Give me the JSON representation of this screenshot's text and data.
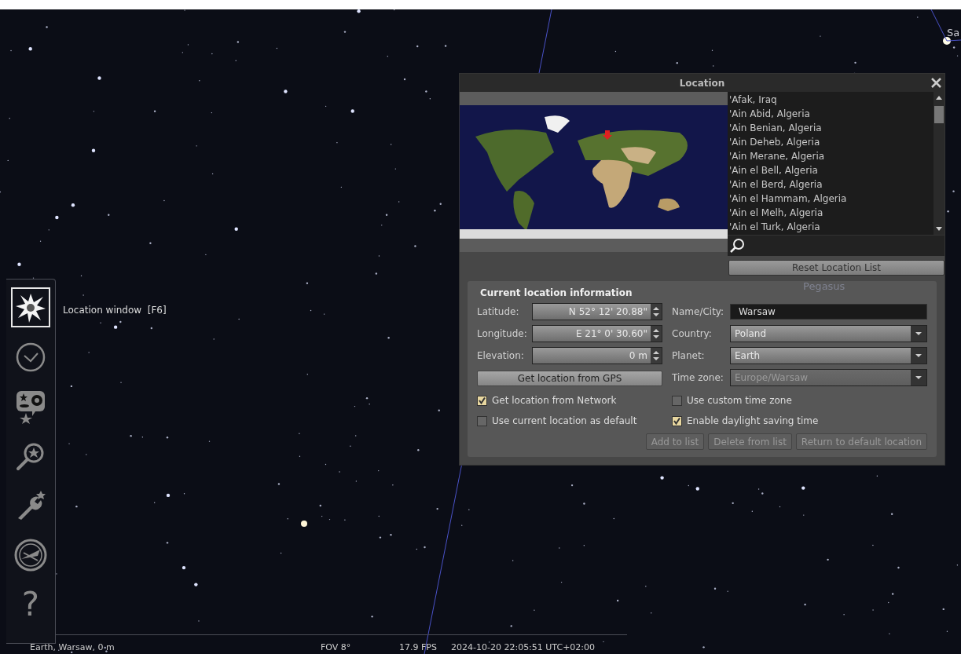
{
  "sky": {
    "planet_label": "Sa",
    "constellation_label": "Pegasus"
  },
  "toolbar": {
    "items": [
      {
        "kind": "location",
        "selected": true
      },
      {
        "kind": "clock",
        "selected": false
      },
      {
        "kind": "sky-objects",
        "selected": false
      },
      {
        "kind": "search",
        "selected": false
      },
      {
        "kind": "settings",
        "selected": false
      },
      {
        "kind": "view",
        "selected": false
      },
      {
        "kind": "help",
        "label": "?",
        "selected": false
      }
    ],
    "tooltip": "Location window  [F6]"
  },
  "location_dialog": {
    "title": "Location",
    "locations": [
      "'Afak, Iraq",
      "'Ain Abid, Algeria",
      "'Ain Benian, Algeria",
      "'Ain Deheb, Algeria",
      "'Ain Merane, Algeria",
      "'Ain el Bell, Algeria",
      "'Ain el Berd, Algeria",
      "'Ain el Hammam, Algeria",
      "'Ain el Melh, Algeria",
      "'Ain el Turk, Algeria"
    ],
    "reset_button": "Reset Location List",
    "current": {
      "title": "Current location information",
      "spinners": [
        {
          "label": "Latitude:",
          "value": "N 52° 12' 20.88\""
        },
        {
          "label": "Longitude:",
          "value": "E 21° 0' 30.60\""
        },
        {
          "label": "Elevation:",
          "value": "0 m"
        }
      ],
      "gps_button": "Get location from GPS",
      "name_field": {
        "label": "Name/City:",
        "value": "Warsaw"
      },
      "combos": [
        {
          "label": "Country:",
          "value": "Poland",
          "disabled": false
        },
        {
          "label": "Planet:",
          "value": "Earth",
          "disabled": false
        },
        {
          "label": "Time zone:",
          "value": "Europe/Warsaw",
          "disabled": true
        }
      ],
      "left_checkboxes": [
        {
          "label": "Get location from Network",
          "checked": true
        },
        {
          "label": "Use current location as default",
          "checked": false
        }
      ],
      "right_checkboxes": [
        {
          "label": "Use custom time zone",
          "checked": false
        },
        {
          "label": "Enable daylight saving time",
          "checked": true
        }
      ],
      "buttons": [
        {
          "label": "Add to list",
          "disabled": true
        },
        {
          "label": "Delete from list",
          "disabled": true
        },
        {
          "label": "Return to default location",
          "disabled": true
        }
      ]
    }
  },
  "status_bar": {
    "location": "Earth, Warsaw, 0 m",
    "fov": "FOV 8°",
    "fps": "17.9 FPS",
    "datetime": "2024-10-20 22:05:51 UTC+02:00"
  }
}
